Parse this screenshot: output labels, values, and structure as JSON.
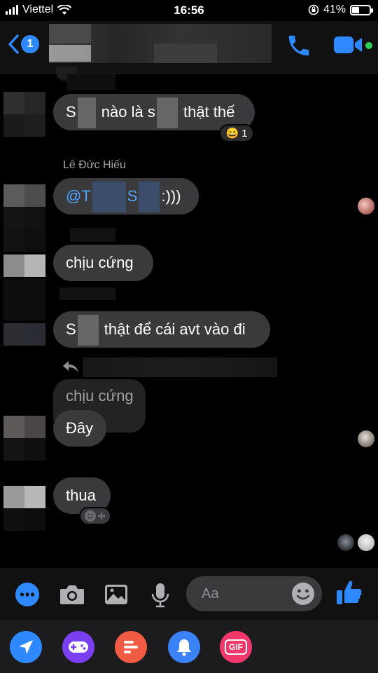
{
  "status_bar": {
    "carrier": "Viettel",
    "time": "16:56",
    "battery": "41%",
    "battery_level": 0.41
  },
  "header": {
    "unread_count": "1"
  },
  "messages": {
    "m1_text_a": "S",
    "m1_text_b": " nào là s",
    "m1_text_c": " thật thế",
    "m1_reaction_emoji": "😄",
    "m1_reaction_count": "1",
    "sender_name": "Lê Đức Hiếu",
    "m2_text_a": "@T",
    "m2_text_b": "S",
    "m2_text_c": ":)))",
    "m3_text": "chịu cứng",
    "m4_text_a": "S",
    "m4_text_b": " thật để cái avt vào đi",
    "quoted_text": "chịu cứng",
    "m5_text": "Đây",
    "m6_text": "thua"
  },
  "composer": {
    "placeholder": "Aa"
  },
  "apps": {
    "gif_label": "GIF"
  },
  "colors": {
    "accent": "#2e89ff",
    "bubble": "#3a3a3c",
    "online": "#30d158"
  }
}
